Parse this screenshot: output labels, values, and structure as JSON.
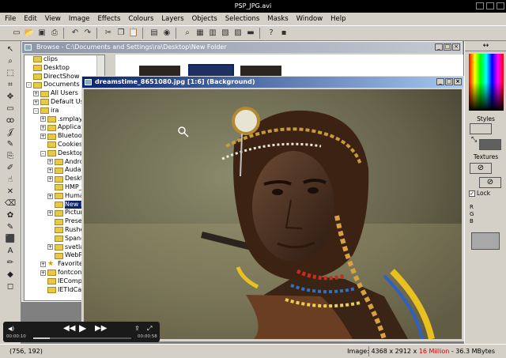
{
  "window": {
    "title": "PSP_JPG.avi"
  },
  "menu": [
    "File",
    "Edit",
    "View",
    "Image",
    "Effects",
    "Colours",
    "Layers",
    "Objects",
    "Selections",
    "Masks",
    "Window",
    "Help"
  ],
  "toolbar_icons": [
    "new-icon",
    "open-icon",
    "save-icon",
    "print-icon",
    "undo-icon",
    "redo-icon",
    "cut-icon",
    "copy-icon",
    "paste-icon",
    "browse-icon",
    "capture-icon",
    "zoom-icon",
    "full-screen-icon",
    "histogram-icon",
    "color-balance-icon",
    "display-icon",
    "toolbar-icon",
    "help-icon",
    "lock-icon"
  ],
  "left_tools": [
    "arrow-icon",
    "zoom-icon",
    "deform-icon",
    "crop-icon",
    "mover-icon",
    "selection-icon",
    "lasso-icon",
    "dropper-icon",
    "paintbrush-icon",
    "clone-icon",
    "color-replacer-icon",
    "retouch-icon",
    "scratch-remover-icon",
    "eraser-icon",
    "picture-tube-icon",
    "airbrush-icon",
    "flood-fill-icon",
    "text-icon",
    "draw-icon",
    "preset-shapes-icon",
    "object-selector-icon"
  ],
  "browse": {
    "title": "Browse - C:\\Documents and Settings\\ra\\Desktop\\New Folder",
    "tree": [
      {
        "label": "clips",
        "level": 0,
        "pm": ""
      },
      {
        "label": "Desktop",
        "level": 0,
        "pm": ""
      },
      {
        "label": "DirectShow",
        "level": 0,
        "pm": ""
      },
      {
        "label": "Documents and Se",
        "level": 0,
        "pm": "-"
      },
      {
        "label": "All Users",
        "level": 1,
        "pm": "+"
      },
      {
        "label": "Default User",
        "level": 1,
        "pm": "+"
      },
      {
        "label": "ira",
        "level": 1,
        "pm": "-"
      },
      {
        "label": ".smplayer",
        "level": 2,
        "pm": "+"
      },
      {
        "label": "Application",
        "level": 2,
        "pm": "+"
      },
      {
        "label": "Bluetooth S",
        "level": 2,
        "pm": "+"
      },
      {
        "label": "Cookies",
        "level": 2,
        "pm": ""
      },
      {
        "label": "Desktop",
        "level": 2,
        "pm": "-"
      },
      {
        "label": "Androi",
        "level": 3,
        "pm": "+"
      },
      {
        "label": "Audac",
        "level": 3,
        "pm": "+"
      },
      {
        "label": "Deskto",
        "level": 3,
        "pm": "+"
      },
      {
        "label": "HMP_M",
        "level": 3,
        "pm": ""
      },
      {
        "label": "Human",
        "level": 3,
        "pm": "+"
      },
      {
        "label": "New Fo",
        "level": 3,
        "pm": ""
      },
      {
        "label": "Picture",
        "level": 3,
        "pm": "+"
      },
      {
        "label": "Presen",
        "level": 3,
        "pm": ""
      },
      {
        "label": "Rushes",
        "level": 3,
        "pm": ""
      },
      {
        "label": "Spanda",
        "level": 3,
        "pm": ""
      },
      {
        "label": "svetlar",
        "level": 3,
        "pm": "+"
      },
      {
        "label": "WebP",
        "level": 3,
        "pm": ""
      },
      {
        "label": "Favorites",
        "level": 2,
        "pm": "+",
        "star": true
      },
      {
        "label": "fontconfig",
        "level": 2,
        "pm": "+"
      },
      {
        "label": "IECompatC",
        "level": 2,
        "pm": ""
      },
      {
        "label": "IETldCache",
        "level": 2,
        "pm": ""
      }
    ]
  },
  "image_window": {
    "title": "dreamstime_8651080.jpg [1:6] (Background)"
  },
  "right_panel": {
    "styles_label": "Styles",
    "textures_label": "Textures",
    "lock_label": "Lock",
    "rgb": [
      "R",
      "G",
      "B"
    ]
  },
  "player": {
    "elapsed": "00:00:10",
    "total": "00:00:58",
    "progress": 0.17
  },
  "status": {
    "coords": "(756, 192)",
    "image_prefix": "Image:  4368 x 2912 x ",
    "image_colors": "16 Million",
    "image_suffix": " - 36.3 MBytes"
  },
  "colors": {
    "title_active": "#0a246a",
    "title_inactive": "#8d96a6",
    "chrome": "#d4d0c8"
  }
}
